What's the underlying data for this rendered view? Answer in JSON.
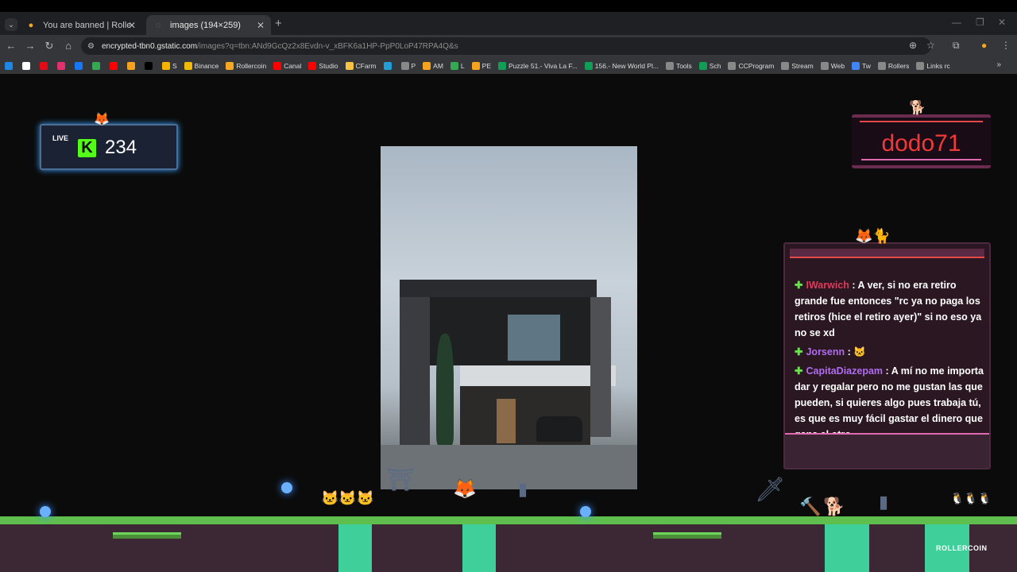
{
  "browser": {
    "tabs": [
      {
        "title": "You are banned | RollerCoin.com",
        "icon": "rollercoin-icon",
        "active": false
      },
      {
        "title": "images (194×259)",
        "icon": "image-icon",
        "active": true
      }
    ],
    "new_tab_symbol": "+",
    "close_symbol": "✕",
    "url_host": "encrypted-tbn0.gstatic.com",
    "url_path": "/images?q=tbn:ANd9GcQz2x8Evdn-v_xBFK6a1HP-PpP0LoP47RPA4Q&s",
    "bookmarks": [
      {
        "label": "",
        "color": "#1e88e5"
      },
      {
        "label": "",
        "color": "#ffffff"
      },
      {
        "label": "",
        "color": "#e50914"
      },
      {
        "label": "",
        "color": "#e1306c"
      },
      {
        "label": "",
        "color": "#1877f2"
      },
      {
        "label": "",
        "color": "#34a853"
      },
      {
        "label": "",
        "color": "#ff0000"
      },
      {
        "label": "",
        "color": "#f6a21e"
      },
      {
        "label": "",
        "color": "#000000"
      },
      {
        "label": "S",
        "color": "#f4b400"
      },
      {
        "label": "Binance",
        "color": "#f0b90b"
      },
      {
        "label": "Rollercoin",
        "color": "#f5a623"
      },
      {
        "label": "Canal",
        "color": "#ff0000"
      },
      {
        "label": "Studio",
        "color": "#ff0000"
      },
      {
        "label": "CFarm",
        "color": "#f6c343"
      },
      {
        "label": "",
        "color": "#229ed9"
      },
      {
        "label": "P",
        "color": "#888888"
      },
      {
        "label": "AM",
        "color": "#f6a21e"
      },
      {
        "label": "L",
        "color": "#34a853"
      },
      {
        "label": "PE",
        "color": "#f6a21e"
      },
      {
        "label": "Puzzle 51.- Viva La F...",
        "color": "#0f9d58"
      },
      {
        "label": "156.- New World Pl...",
        "color": "#0f9d58"
      },
      {
        "label": "Tools",
        "color": "#888888"
      },
      {
        "label": "Sch",
        "color": "#0f9d58"
      },
      {
        "label": "CCProgram",
        "color": "#888888"
      },
      {
        "label": "Stream",
        "color": "#888888"
      },
      {
        "label": "Web",
        "color": "#888888"
      },
      {
        "label": "Tw",
        "color": "#4285f4"
      },
      {
        "label": "Rollers",
        "color": "#888888"
      },
      {
        "label": "Links rc",
        "color": "#888888"
      }
    ]
  },
  "stream": {
    "live_label": "LIVE",
    "viewer_count": "234",
    "kick_letter": "K",
    "username": "dodo71",
    "brand": "ROLLERCOIN",
    "chat": [
      {
        "user": "IWarwich",
        "text": ": A ver, si no era retiro grande fue entonces \"rc ya no paga los retiros (hice el retiro ayer)\" si no eso ya no se xd"
      },
      {
        "user": "Jorsenn",
        "text": ": 🐱"
      },
      {
        "user": "CapitaDiazepam",
        "text": ": A mí no me importa dar y regalar pero no me gustan las que pueden, si quieres algo pues trabaja tú, es que es muy fácil gastar el dinero que gana el otro"
      }
    ]
  }
}
